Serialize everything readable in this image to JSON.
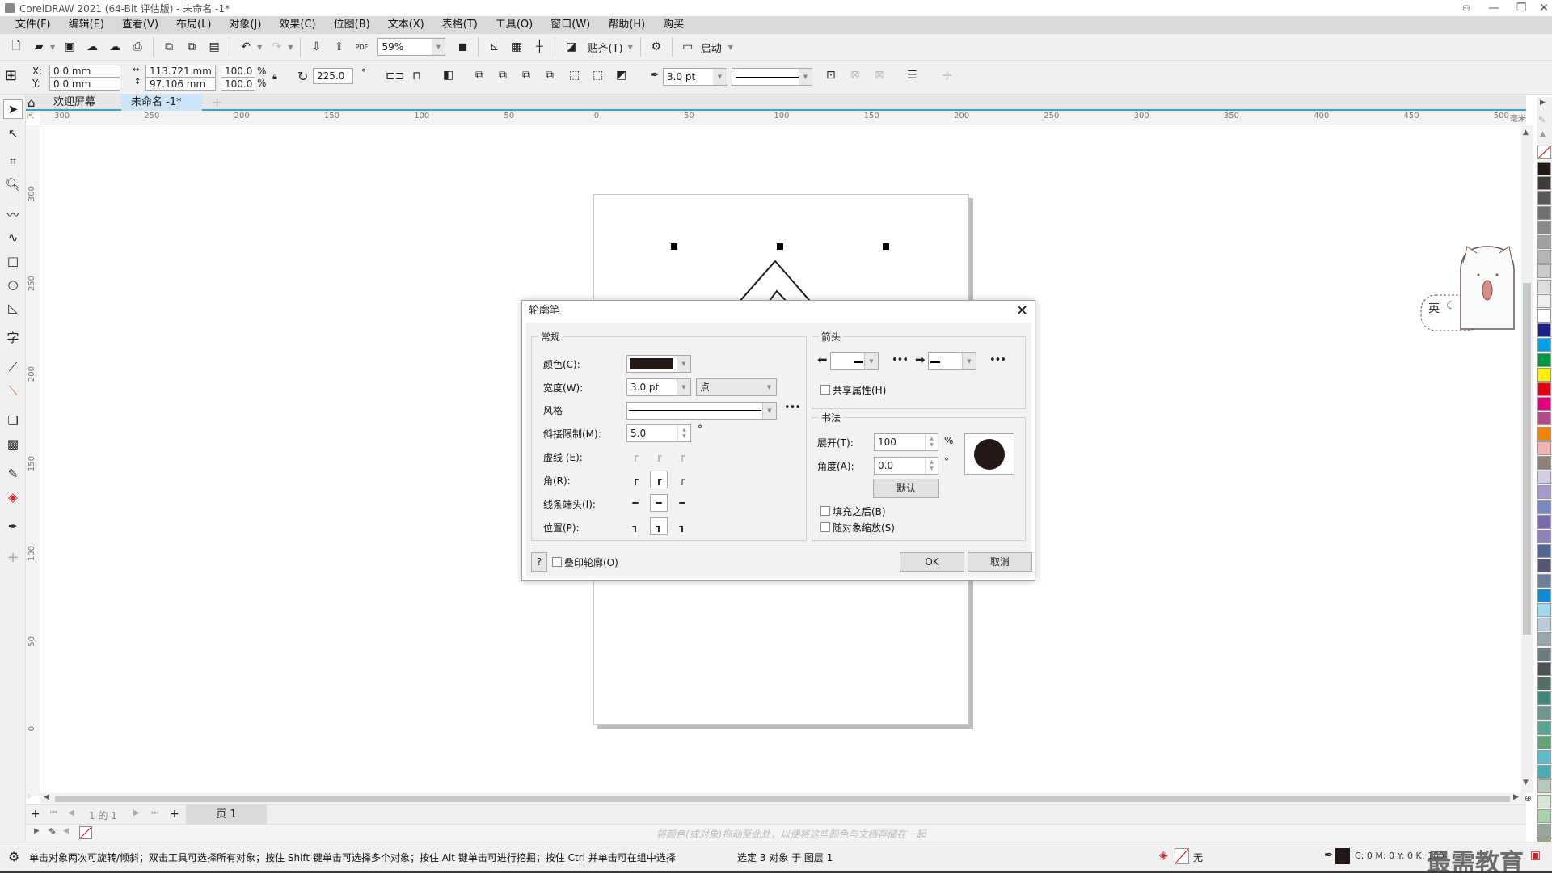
{
  "window": {
    "title": "CorelDRAW 2021 (64-Bit 评估版) - 未命名 -1*"
  },
  "menu": [
    "文件(F)",
    "编辑(E)",
    "查看(V)",
    "布局(L)",
    "对象(J)",
    "效果(C)",
    "位图(B)",
    "文本(X)",
    "表格(T)",
    "工具(O)",
    "窗口(W)",
    "帮助(H)",
    "购买"
  ],
  "toolbar": {
    "zoom_value": "59%",
    "snap_label": "贴齐(T)",
    "launch_label": "启动",
    "pdf_label": "PDF"
  },
  "property_bar": {
    "x_label": "X:",
    "y_label": "Y:",
    "x_value": "0.0 mm",
    "y_value": "0.0 mm",
    "width_value": "113.721 mm",
    "height_value": "97.106 mm",
    "scale_x": "100.0",
    "scale_y": "100.0",
    "percent": "%",
    "rotation": "225.0",
    "degree": "°",
    "outline_width": "3.0 pt"
  },
  "doc_tabs": [
    {
      "label": "欢迎屏幕",
      "active": false
    },
    {
      "label": "未命名 -1*",
      "active": true
    }
  ],
  "ruler_h": {
    "ticks": [
      "300",
      "250",
      "200",
      "150",
      "100",
      "50",
      "0",
      "50",
      "100",
      "150",
      "200",
      "250",
      "300",
      "350",
      "400",
      "450",
      "500"
    ],
    "unit": "毫米"
  },
  "ruler_v": {
    "ticks": [
      "300",
      "250",
      "200",
      "150",
      "100",
      "50",
      "0"
    ]
  },
  "dialog": {
    "title": "轮廓笔",
    "general": {
      "group_title": "常规",
      "color_label": "颜色(C):",
      "color_value": "#231815",
      "width_label": "宽度(W):",
      "width_value": "3.0 pt",
      "width_unit": "点",
      "style_label": "风格",
      "miter_label": "斜接限制(M):",
      "miter_value": "5.0",
      "miter_unit": "°",
      "dash_label": "虚线 (E):",
      "corner_label": "角(R):",
      "cap_label": "线条端头(I):",
      "position_label": "位置(P):"
    },
    "arrows": {
      "group_title": "箭头",
      "share_label": "共享属性(H)",
      "share_checked": false
    },
    "calligraphy": {
      "group_title": "书法",
      "stretch_label": "展开(T):",
      "stretch_value": "100",
      "stretch_unit": "%",
      "angle_label": "角度(A):",
      "angle_value": "0.0",
      "angle_unit": "°",
      "default_label": "默认",
      "behind_fill_label": "填充之后(B)",
      "behind_fill_checked": false,
      "scale_label": "随对象缩放(S)",
      "scale_checked": false
    },
    "help_label": "?",
    "overprint_label": "叠印轮廓(O)",
    "overprint_checked": false,
    "ok_label": "OK",
    "cancel_label": "取消"
  },
  "page_nav": {
    "page_count_text": "1 的 1",
    "page_tab": "页 1"
  },
  "color_bar": {
    "hint": "将颜色(或对象)拖动至此处，以便将这些颜色与文档存储在一起"
  },
  "status": {
    "hint": "单击对象两次可旋转/倾斜；双击工具可选择所有对象；按住 Shift 键单击可选择多个对象；按住 Alt 键单击可进行挖掘；按住 Ctrl 并单击可在组中选择",
    "selection": "选定 3 对象 于 图层 1",
    "fill_label": "无",
    "outline_cmyk": "C: 0 M: 0 Y: 0 K: 100",
    "watermark": "最需教育"
  },
  "ime_widget": {
    "label": "英"
  },
  "palette": [
    "#231815",
    "#3e3a39",
    "#595757",
    "#727171",
    "#898989",
    "#9fa0a0",
    "#b5b5b6",
    "#c9caca",
    "#dcdddd",
    "#efefef",
    "#ffffff",
    "#1d2088",
    "#00a0e9",
    "#009944",
    "#fff100",
    "#e60012",
    "#e4007f",
    "#b5478c",
    "#f08300",
    "#f5b2b2",
    "#8f8078",
    "#d0cde6",
    "#a59aca",
    "#7489c6",
    "#7c6ab0",
    "#8f82bc",
    "#4f6795",
    "#585574",
    "#6a7f9a",
    "#0e8bd6",
    "#a0d8ef",
    "#b7ccd8",
    "#98a7ac",
    "#6d7b82",
    "#4b5256",
    "#4f6f67",
    "#3f8778",
    "#6e9690",
    "#56a595",
    "#5da373",
    "#5cbdca",
    "#4aaab6",
    "#b8c8b9",
    "#d4e6d4",
    "#a5d3a6",
    "#98a69b",
    "#9ba379"
  ]
}
